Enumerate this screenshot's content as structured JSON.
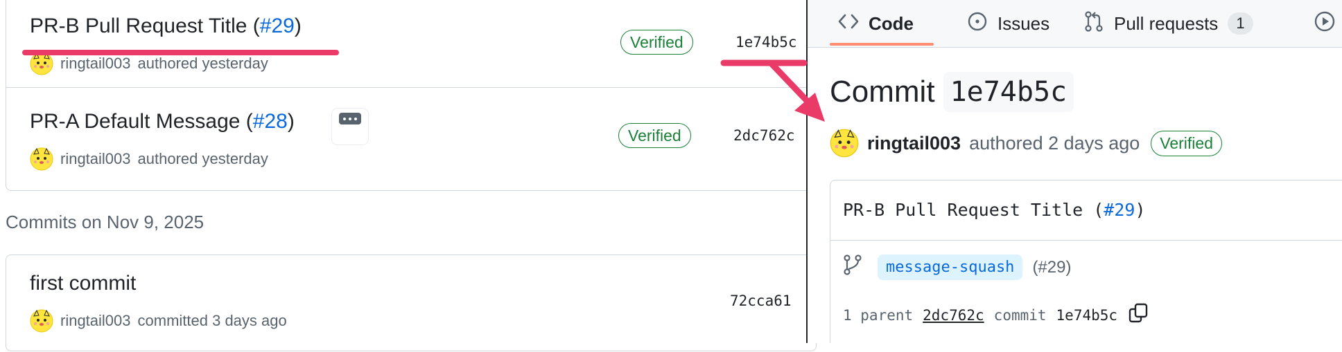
{
  "left_pane": {
    "commits_top": [
      {
        "title_text": "PR-B Pull Request Title (",
        "pr_ref": "#29",
        "title_close": ")",
        "author": "ringtail003",
        "action": "authored yesterday",
        "verified_label": "Verified",
        "sha": "1e74b5c"
      },
      {
        "title_text": "PR-A Default Message (",
        "pr_ref": "#28",
        "title_close": ")",
        "author": "ringtail003",
        "action": "authored yesterday",
        "verified_label": "Verified",
        "sha": "2dc762c"
      }
    ],
    "date_heading": "Commits on Nov 9, 2025",
    "commits_bottom": [
      {
        "title_text": "first commit",
        "author": "ringtail003",
        "action": "committed 3 days ago",
        "sha": "72cca61"
      }
    ]
  },
  "right_pane": {
    "tabs": [
      {
        "icon": "code-icon",
        "label": "Code",
        "active": true
      },
      {
        "icon": "issue-opened-icon",
        "label": "Issues"
      },
      {
        "icon": "git-pull-request-icon",
        "label": "Pull requests",
        "counter": "1"
      },
      {
        "icon": "play-icon",
        "label": ""
      }
    ],
    "heading_label": "Commit",
    "heading_sha": "1e74b5c",
    "author": "ringtail003",
    "authored_text": "authored 2 days ago",
    "verified_label": "Verified",
    "message_text": "PR-B Pull Request Title (",
    "message_pr": "#29",
    "message_close": ")",
    "branch_name": "message-squash",
    "branch_pr": "(#29)",
    "parent_label": "1 parent",
    "parent_sha": "2dc762c",
    "commit_label": "commit",
    "commit_sha": "1e74b5c"
  },
  "colors": {
    "link": "#0969da",
    "verified_green": "#1a7f37",
    "annotation_pink": "#ea3a68",
    "active_tab_underline": "#fd8c73",
    "muted_text": "#59636e"
  }
}
